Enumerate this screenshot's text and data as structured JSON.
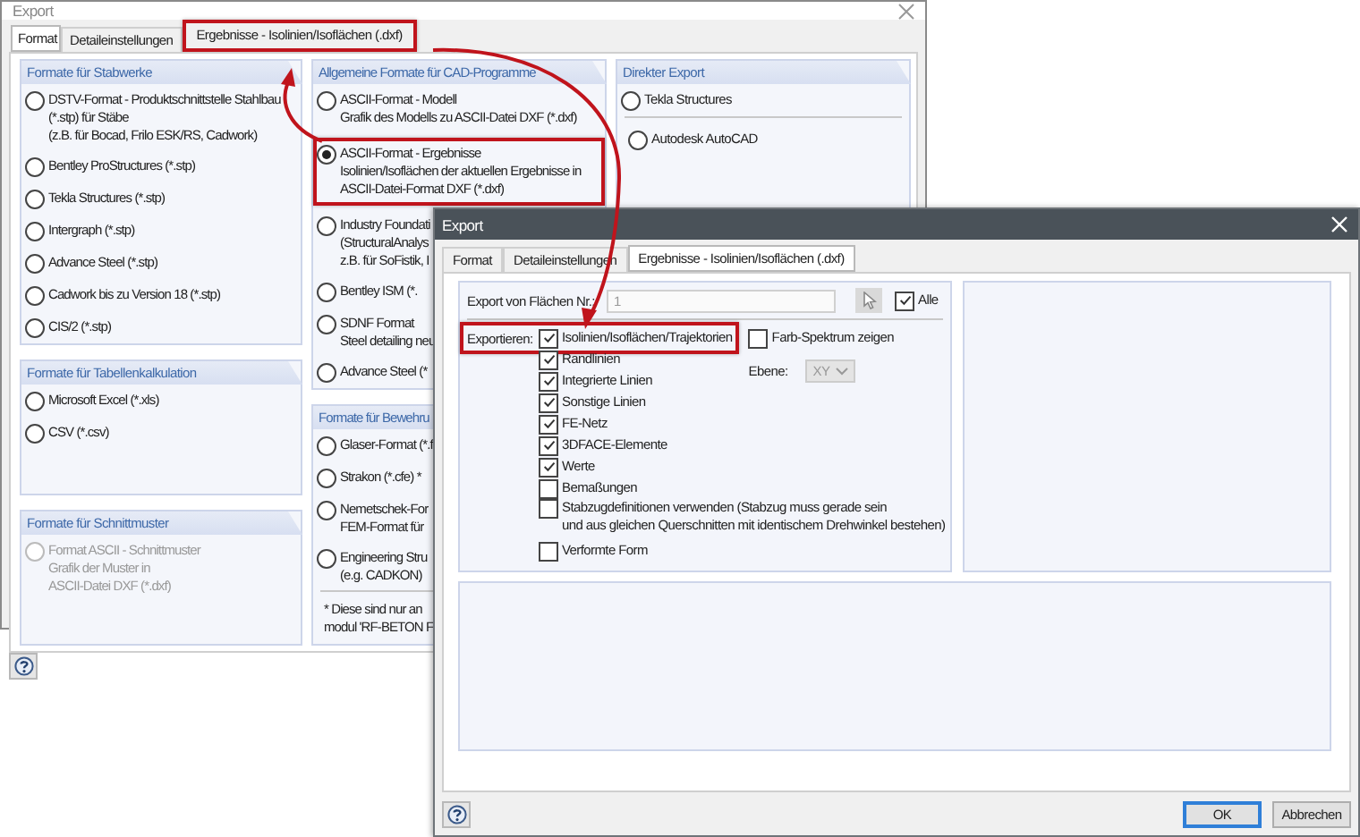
{
  "back_window": {
    "title": "Export",
    "tabs": [
      {
        "label": "Format",
        "selected": true,
        "highlighted": false
      },
      {
        "label": "Detaileinstellungen",
        "selected": false,
        "highlighted": false
      },
      {
        "label": "Ergebnisse - Isolinien/Isoflächen (.dxf)",
        "selected": false,
        "highlighted": true
      }
    ],
    "columns": [
      [
        {
          "title": "Formate für Stabwerke",
          "options": [
            {
              "lines": [
                "DSTV-Format - Produktschnittstelle Stahlbau",
                "(*.stp) für Stäbe",
                "(z.B. für Bocad, Frilo ESK/RS, Cadwork)"
              ],
              "selected": false,
              "disabled": false,
              "highlighted": false
            },
            {
              "lines": [
                "Bentley ProStructures (*.stp)"
              ],
              "selected": false,
              "disabled": false,
              "highlighted": false
            },
            {
              "lines": [
                "Tekla Structures (*.stp)"
              ],
              "selected": false,
              "disabled": false,
              "highlighted": false
            },
            {
              "lines": [
                "Intergraph (*.stp)"
              ],
              "selected": false,
              "disabled": false,
              "highlighted": false
            },
            {
              "lines": [
                "Advance Steel (*.stp)"
              ],
              "selected": false,
              "disabled": false,
              "highlighted": false
            },
            {
              "lines": [
                "Cadwork bis zu Version 18 (*.stp)"
              ],
              "selected": false,
              "disabled": false,
              "highlighted": false
            },
            {
              "lines": [
                "CIS/2 (*.stp)"
              ],
              "selected": false,
              "disabled": false,
              "highlighted": false
            }
          ]
        },
        {
          "title": "Formate für Tabellenkalkulation",
          "options": [
            {
              "lines": [
                "Microsoft Excel (*.xls)"
              ],
              "selected": false,
              "disabled": false,
              "highlighted": false
            },
            {
              "lines": [
                "CSV (*.csv)"
              ],
              "selected": false,
              "disabled": false,
              "highlighted": false
            }
          ]
        },
        {
          "title": "Formate für Schnittmuster",
          "options": [
            {
              "lines": [
                "Format ASCII - Schnittmuster",
                "Grafik der Muster in",
                "ASCII-Datei DXF (*.dxf)"
              ],
              "selected": false,
              "disabled": true,
              "highlighted": false
            }
          ]
        }
      ],
      [
        {
          "title": "Allgemeine Formate für CAD-Programme",
          "options": [
            {
              "lines": [
                "ASCII-Format - Modell",
                "Grafik des Modells zu ASCII-Datei DXF (*.dxf)"
              ],
              "selected": false,
              "disabled": false,
              "highlighted": false
            },
            {
              "lines": [
                "ASCII-Format - Ergebnisse",
                "Isolinien/Isoflächen der aktuellen Ergebnisse in",
                "ASCII-Datei-Format DXF (*.dxf)"
              ],
              "selected": true,
              "disabled": false,
              "highlighted": true
            },
            {
              "lines": [
                "Industry Foundati",
                "(StructuralAnalys",
                "z.B. für SoFistik, I"
              ],
              "selected": false,
              "disabled": false,
              "highlighted": false
            },
            {
              "lines": [
                "Bentley ISM (*."
              ],
              "selected": false,
              "disabled": false,
              "highlighted": false
            },
            {
              "lines": [
                "SDNF Format",
                "Steel detailing neu"
              ],
              "selected": false,
              "disabled": false,
              "highlighted": false
            },
            {
              "lines": [
                "Advance Steel (*"
              ],
              "selected": false,
              "disabled": false,
              "highlighted": false
            }
          ]
        },
        {
          "title": "Formate für Bewehru",
          "options": [
            {
              "lines": [
                "Glaser-Format (*.f"
              ],
              "selected": false,
              "disabled": false,
              "highlighted": false
            },
            {
              "lines": [
                "Strakon (*.cfe)  *"
              ],
              "selected": false,
              "disabled": false,
              "highlighted": false
            },
            {
              "lines": [
                "Nemetschek-For",
                "FEM-Format für"
              ],
              "selected": false,
              "disabled": false,
              "highlighted": false
            },
            {
              "lines": [
                "Engineering Stru",
                "(e.g. CADKON)"
              ],
              "selected": false,
              "disabled": false,
              "highlighted": false
            }
          ],
          "note": [
            "* Diese sind nur an",
            "modul 'RF-BETON F"
          ]
        }
      ],
      [
        {
          "title": "Direkter Export",
          "options": [
            {
              "lines": [
                "Tekla Structures"
              ],
              "selected": false,
              "disabled": false,
              "highlighted": false
            },
            {
              "lines": [
                "Autodesk AutoCAD"
              ],
              "selected": false,
              "disabled": false,
              "highlighted": false
            }
          ]
        }
      ]
    ]
  },
  "front_window": {
    "title": "Export",
    "tabs": [
      {
        "label": "Format",
        "selected": false
      },
      {
        "label": "Detaileinstellungen",
        "selected": false
      },
      {
        "label": "Ergebnisse - Isolinien/Isoflächen (.dxf)",
        "selected": true
      }
    ],
    "surface": {
      "label": "Export von Flächen Nr.:",
      "value": "1",
      "disabled": true,
      "all": {
        "label": "Alle",
        "checked": true
      }
    },
    "export": {
      "label": "Exportieren:",
      "highlighted": true,
      "options": [
        {
          "lines": [
            "Isolinien/Isoflächen/Trajektorien"
          ],
          "checked": true
        },
        {
          "lines": [
            "Randlinien"
          ],
          "checked": true
        },
        {
          "lines": [
            "Integrierte Linien"
          ],
          "checked": true
        },
        {
          "lines": [
            "Sonstige Linien"
          ],
          "checked": true
        },
        {
          "lines": [
            "FE-Netz"
          ],
          "checked": true
        },
        {
          "lines": [
            "3DFACE-Elemente"
          ],
          "checked": true
        },
        {
          "lines": [
            "Werte"
          ],
          "checked": true
        },
        {
          "lines": [
            "Bemaßungen"
          ],
          "checked": false
        },
        {
          "lines": [
            "Stabzugdefinitionen verwenden (Stabzug muss gerade sein",
            "und aus gleichen Querschnitten mit identischem Drehwinkel bestehen)"
          ],
          "checked": false
        },
        {
          "lines": [
            "Verformte Form"
          ],
          "checked": false
        }
      ]
    },
    "spectrum": {
      "label": "Farb-Spektrum zeigen",
      "checked": false
    },
    "plane": {
      "label": "Ebene:",
      "value": "XY",
      "disabled": true
    },
    "buttons": [
      {
        "label": "OK",
        "selected": true
      },
      {
        "label": "Abbrechen",
        "selected": false
      }
    ]
  }
}
